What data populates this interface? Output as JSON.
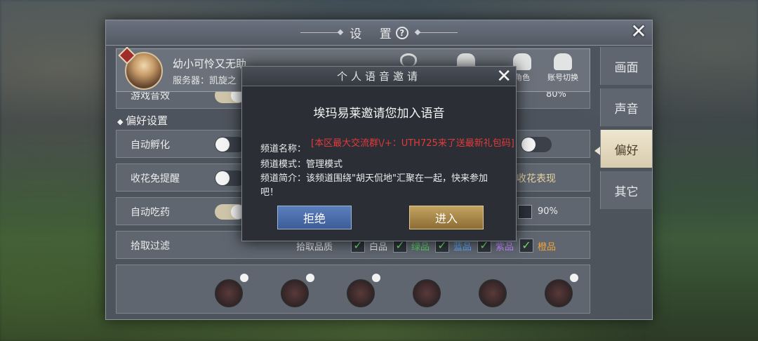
{
  "settings": {
    "title": "设  置",
    "close": "✕",
    "tabs": [
      {
        "label": "画面",
        "active": false
      },
      {
        "label": "声音",
        "active": false
      },
      {
        "label": "偏好",
        "active": true
      },
      {
        "label": "其它",
        "active": false
      }
    ],
    "profile": {
      "name": "幼小可怜又无助",
      "server": "服务器：凯旋之",
      "actions": [
        "",
        "",
        "角色",
        "账号切换"
      ]
    },
    "rows": {
      "game_sfx_label": "游戏音效",
      "game_sfx_value": "80%",
      "section_title": "偏好设置",
      "auto_hatch": "自动孵化",
      "flower_no_remind": "收花免提醒",
      "flower_effect": "收花表现",
      "auto_potion": "自动吃药",
      "potion_threshold": "90%",
      "pickup_filter": "拾取过滤",
      "pickup_quality_label": "拾取品质",
      "qualities": [
        {
          "label": "白品",
          "color": "#e6e6e6"
        },
        {
          "label": "绿品",
          "color": "#57d35f"
        },
        {
          "label": "蓝品",
          "color": "#5aa8ff"
        },
        {
          "label": "紫品",
          "color": "#c38cff"
        },
        {
          "label": "橙品",
          "color": "#f2a33a"
        }
      ]
    }
  },
  "modal": {
    "title": "个人语音邀请",
    "close": "✕",
    "headline": "埃玛易莱邀请您加入语音",
    "channel_name_label": "频道名称：",
    "channel_name_value": "[本区最大交流群\\/+：UTH725来了送最新礼包码]",
    "channel_mode_label": "频道模式：",
    "channel_mode_value": "管理模式",
    "channel_desc_label": "频道简介：",
    "channel_desc_value": "该频道围绕\"胡天侃地\"汇聚在一起，快来参加吧！",
    "reject_label": "拒绝",
    "enter_label": "进入",
    "reject_color": "#4a6dad",
    "enter_color": "#a8883f"
  }
}
